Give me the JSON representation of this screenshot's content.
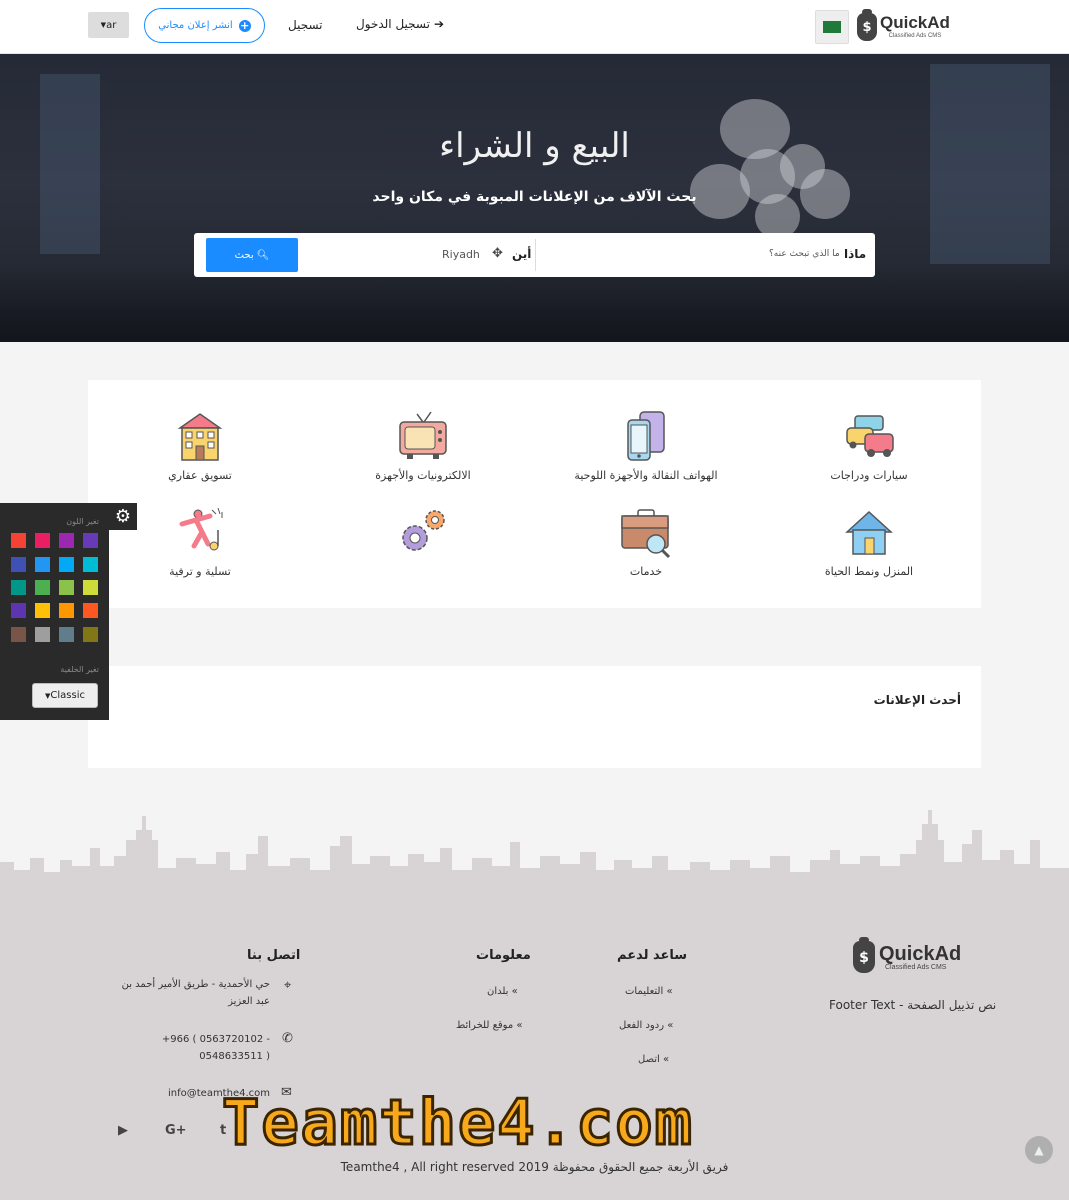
{
  "header": {
    "logo_name": "QuickAd",
    "logo_tagline": "Classified Ads CMS",
    "login_label": "تسجيل الدخول",
    "register_label": "تسجيل",
    "post_ad_label": "انشر إعلان مجاني",
    "lang_label": "ar"
  },
  "hero": {
    "title": "البيع و الشراء",
    "subtitle": "بحث الآلاف من الإعلانات المبوبة في مكان واحد",
    "search": {
      "what_label": "ماذا",
      "what_placeholder": "ما الذي تبحث عنه؟",
      "where_label": "أين",
      "where_value": "Riyadh",
      "button_label": "بحث"
    }
  },
  "categories": [
    {
      "label": "سيارات ودراجات",
      "icon": "car-icon"
    },
    {
      "label": "الهواتف النقالة والأجهزة اللوحية",
      "icon": "phone-tablet-icon"
    },
    {
      "label": "الالكترونيات والأجهزة",
      "icon": "tv-icon"
    },
    {
      "label": "تسويق عقاري",
      "icon": "building-icon"
    },
    {
      "label": "المنزل ونمط الحياة",
      "icon": "house-icon"
    },
    {
      "label": "خدمات",
      "icon": "briefcase-icon"
    },
    {
      "label": "",
      "icon": "gears-icon"
    },
    {
      "label": "تسلية و ترفية",
      "icon": "dancer-icon"
    }
  ],
  "latest": {
    "title": "أحدث الإعلانات"
  },
  "color_panel": {
    "color_label": "تغير اللون",
    "background_label": "تغير الخلفية",
    "background_value": "Classic",
    "swatches": [
      "#f44336",
      "#e91e63",
      "#9c27b0",
      "#673ab7",
      "#3f51b5",
      "#2196f3",
      "#03a9f4",
      "#00bcd4",
      "#009688",
      "#4caf50",
      "#8bc34a",
      "#cddc39",
      "#5e35b1",
      "#ffc107",
      "#ff9800",
      "#ff5722",
      "#795548",
      "#9e9e9e",
      "#607d8b",
      "#827717"
    ]
  },
  "footer": {
    "logo_name": "QuickAd",
    "logo_tagline": "Classified Ads CMS",
    "footer_text": "Footer Text - نص تذييل الصفحة",
    "help_title": "ساعد لدعم",
    "help_links": [
      "التعليمات",
      "ردود الفعل",
      "اتصل"
    ],
    "info_title": "معلومات",
    "info_links": [
      "بلدان",
      "موقع للخرائط"
    ],
    "contact_title": "اتصل بنا",
    "address": "حي الأحمدية - طريق الأمير أحمد بن عبد العزيز",
    "phone": "+966 ( 0563720102 - 0548633511 )",
    "email": "info@teamthe4.com",
    "copyright": "Teamthe4 , All right reserved 2019 فريق الأربعة جميع الحقوق محفوظة",
    "watermark": "Teamthe4.com"
  }
}
